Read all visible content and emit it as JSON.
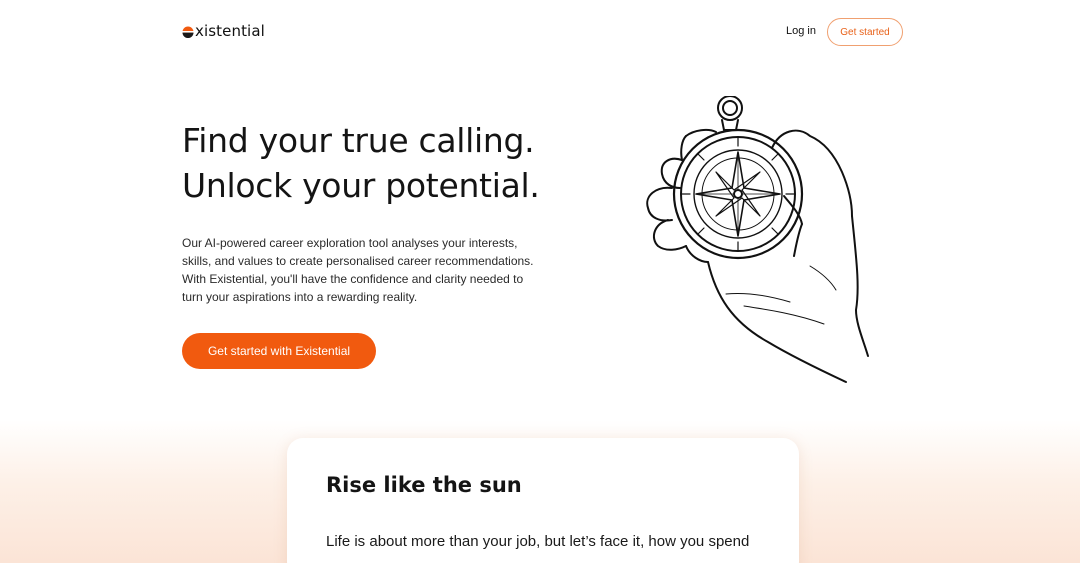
{
  "nav": {
    "brand_rest": "xistential",
    "login_label": "Log in",
    "cta_label": "Get started"
  },
  "hero": {
    "title_line1": "Find your true calling.",
    "title_line2": "Unlock your potential.",
    "description": "Our AI-powered career exploration tool analyses your interests, skills, and values to create personalised career recommendations. With Existential, you'll have the confidence and clarity needed to turn your aspirations into a rewarding reality.",
    "cta_label": "Get started with Existential",
    "illustration": "hand-holding-compass-illustration"
  },
  "card": {
    "title": "Rise like the sun",
    "text": "Life is about more than your job, but let’s face it, how you spend"
  },
  "colors": {
    "brand_orange": "#f15a0f",
    "nav_button_border": "#f0a070",
    "background_gradient_end": "#fbe4d6"
  }
}
